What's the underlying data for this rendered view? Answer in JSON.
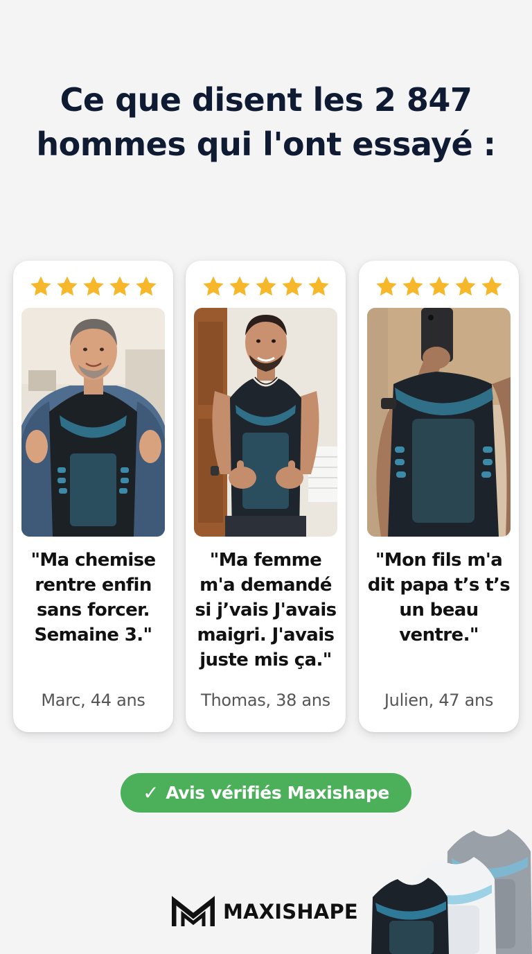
{
  "headline": {
    "line1": "Ce que disent les 2 847",
    "line2": "hommes qui l'ont essayé :"
  },
  "accent_colors": {
    "star": "#f7b72a",
    "badge": "#4caf5a",
    "headline": "#0f1b33"
  },
  "testimonials": [
    {
      "rating": 5,
      "photo_icon": "man-opening-denim-shirt-photo",
      "quote": "\"Ma chemise rentre enfin sans forcer. Semaine 3.\"",
      "author": "Marc, 44 ans"
    },
    {
      "rating": 5,
      "photo_icon": "man-thumbs-up-photo",
      "quote": "\"Ma femme m'a demandé si j’vais J'avais maigri. J'avais juste mis ça.\"",
      "author": "Thomas, 38 ans"
    },
    {
      "rating": 5,
      "photo_icon": "mirror-selfie-photo",
      "quote": "\"Mon fils m'a dit papa t’s t’s un beau ventre.\"",
      "author": "Julien, 47 ans"
    }
  ],
  "badge": {
    "icon": "check-icon",
    "label": "Avis vérifiés Maxishape"
  },
  "brand": {
    "name": "MAXISHAPE",
    "logo_icon": "maxishape-m-logo-icon",
    "product_icon": "compression-tank-tops-icon"
  }
}
